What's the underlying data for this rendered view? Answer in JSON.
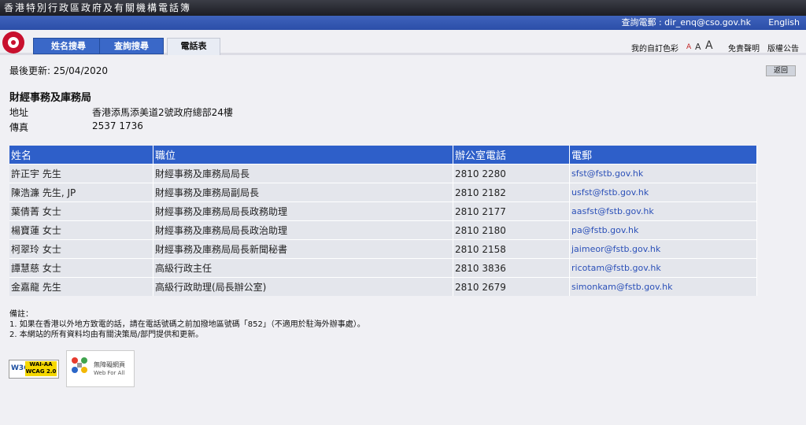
{
  "header": {
    "site_title": "香港特別行政區政府及有關機構電話簿",
    "enquiry_email": "查詢電郵 : dir_enq@cso.gov.hk",
    "language": "English"
  },
  "tabs": [
    {
      "label": "姓名搜尋"
    },
    {
      "label": "查詢搜尋"
    },
    {
      "label": "電話表"
    }
  ],
  "tools": {
    "colour_scheme": "我的自訂色彩",
    "font_sizes": [
      "A",
      "A",
      "A"
    ],
    "disclaimer": "免責聲明",
    "copyright": "版權公告"
  },
  "page": {
    "last_updated": "最後更新: 25/04/2020",
    "back_label": "返回",
    "bureau_name": "財經事務及庫務局",
    "address_label": "地址",
    "address_value": "香港添馬添美道2號政府總部24樓",
    "fax_label": "傳真",
    "fax_value": "2537 1736"
  },
  "table": {
    "headers": [
      "姓名",
      "職位",
      "辦公室電話",
      "電郵"
    ],
    "rows": [
      [
        "許正宇 先生",
        "財經事務及庫務局局長",
        "2810 2280",
        "sfst@fstb.gov.hk"
      ],
      [
        "陳浩濂 先生, JP",
        "財經事務及庫務局副局長",
        "2810 2182",
        "usfst@fstb.gov.hk"
      ],
      [
        "葉倩菁 女士",
        "財經事務及庫務局局長政務助理",
        "2810 2177",
        "aasfst@fstb.gov.hk"
      ],
      [
        "楊寶蓮 女士",
        "財經事務及庫務局局長政治助理",
        "2810 2180",
        "pa@fstb.gov.hk"
      ],
      [
        "柯翠玲 女士",
        "財經事務及庫務局局長新聞秘書",
        "2810 2158",
        "jaimeor@fstb.gov.hk"
      ],
      [
        "譚慧慈 女士",
        "高級行政主任",
        "2810 3836",
        "ricotam@fstb.gov.hk"
      ],
      [
        "金嘉龍 先生",
        "高級行政助理(局長辦公室)",
        "2810 2679",
        "simonkam@fstb.gov.hk"
      ]
    ]
  },
  "notes": {
    "title": "備註：",
    "line1": "1.  如果在香港以外地方致電的話，請在電話號碼之前加撥地區號碼「852」（不適用於駐海外辦事處）。",
    "line2": "2.  本網站的所有資料均由有關決策局/部門提供和更新。"
  },
  "badges": {
    "w3c": "W3C",
    "wcag_line1": "WAI-AA",
    "wcag_line2": "WCAG 2.0",
    "wfa_line1": "無障礙網頁",
    "wfa_line2": "Web For All"
  },
  "colors": {
    "header_blue": "#2e5fc9",
    "tab_blue": "#3a68c8",
    "link": "#2b50b8",
    "emblem_red": "#c8102e"
  }
}
